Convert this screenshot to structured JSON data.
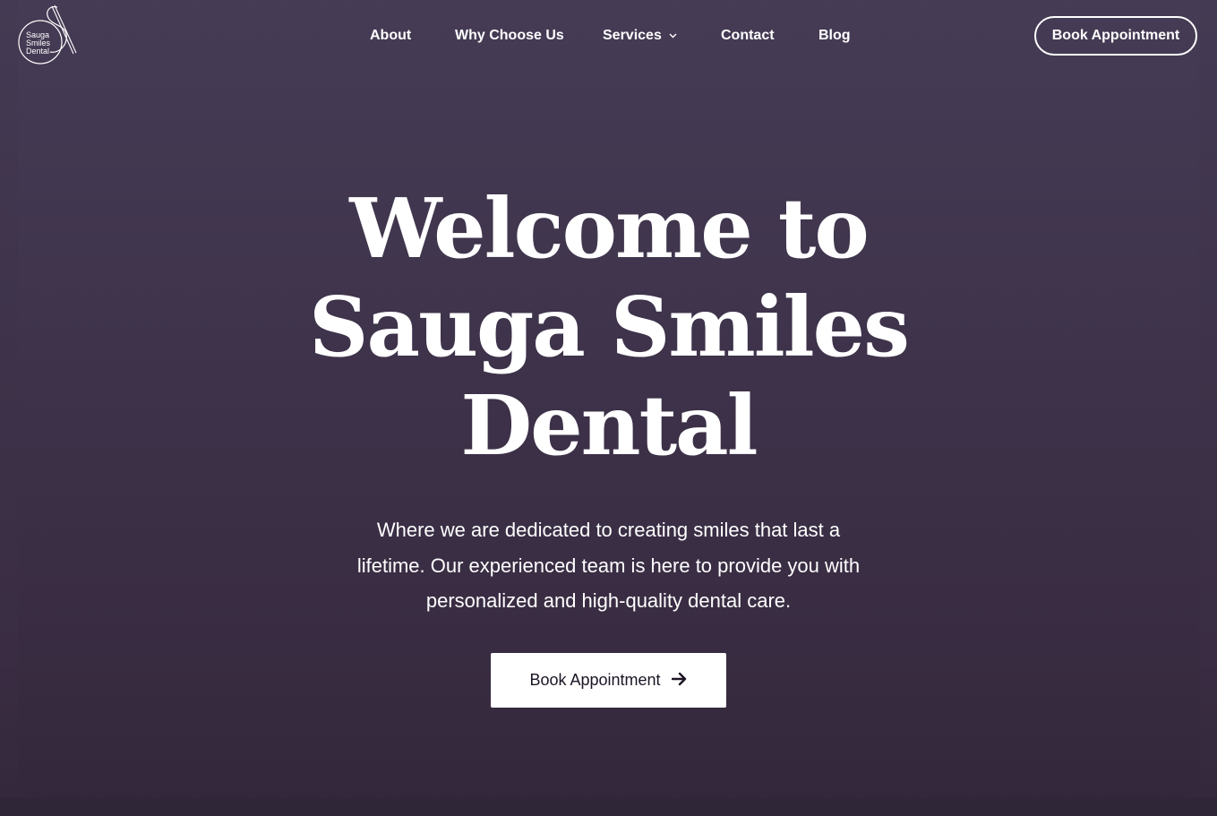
{
  "brand": {
    "logo_lines": [
      "Sauga",
      "Smiles",
      "Dental"
    ]
  },
  "nav": {
    "about": "About",
    "why_choose_us": "Why Choose Us",
    "services": "Services",
    "contact": "Contact",
    "blog": "Blog"
  },
  "header": {
    "cta_label": "Book Appointment"
  },
  "hero": {
    "title_lines": [
      "Welcome to",
      "Sauga Smiles",
      "Dental"
    ],
    "description_lines": [
      "Where we are dedicated to creating smiles that last a",
      "lifetime. Our experienced team is here to provide you with",
      "personalized and high-quality dental care."
    ],
    "cta_label": "Book Appointment",
    "cta_icon": "arrow-right-icon"
  },
  "colors": {
    "background": "#3d3249",
    "text": "#ffffff",
    "button_bg": "#ffffff",
    "button_text": "#1c1424"
  }
}
